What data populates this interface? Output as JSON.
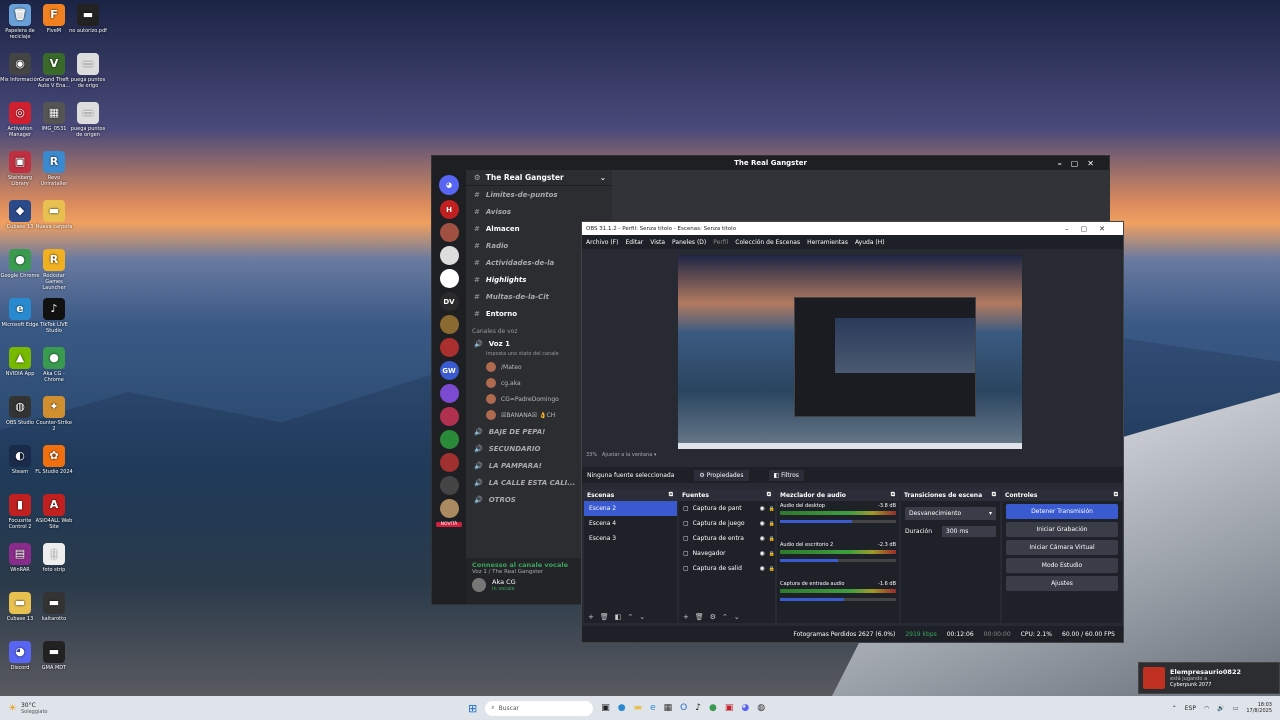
{
  "desktop": {
    "icons": [
      {
        "label": "Papelera de reciclaje",
        "glyph": "🗑",
        "color": "#6aa0d8"
      },
      {
        "label": "FiveM",
        "glyph": "F",
        "color": "#f08020"
      },
      {
        "label": "no autorizo.pdf",
        "glyph": "▬",
        "color": "#222"
      },
      {
        "label": "Mis Información",
        "glyph": "◉",
        "color": "#444"
      },
      {
        "label": "Grand Theft Auto V Ena...",
        "glyph": "V",
        "color": "#3a6a2a"
      },
      {
        "label": "puega puntos de origo",
        "glyph": "▭",
        "color": "#ddd"
      },
      {
        "label": "Activation Manager",
        "glyph": "◎",
        "color": "#d02030"
      },
      {
        "label": "IMG_0531",
        "glyph": "▦",
        "color": "#555"
      },
      {
        "label": "puega puntos de origen",
        "glyph": "▭",
        "color": "#ddd"
      },
      {
        "label": "Steinberg Library",
        "glyph": "▣",
        "color": "#c03040"
      },
      {
        "label": "Revo Uninstaller",
        "glyph": "R",
        "color": "#3a8ad0"
      },
      {
        "label": "Cubase 13",
        "glyph": "◆",
        "color": "#2a4a8a"
      },
      {
        "label": "Nueva carpeta",
        "glyph": "▬",
        "color": "#e8c050"
      },
      {
        "label": "Google Chrome",
        "glyph": "●",
        "color": "#3a9a50"
      },
      {
        "label": "Rockstar Games Launcher",
        "glyph": "R",
        "color": "#f0b020"
      },
      {
        "label": "Microsoft Edge",
        "glyph": "e",
        "color": "#2a8ad0"
      },
      {
        "label": "TikTok LIVE Studio",
        "glyph": "♪",
        "color": "#111"
      },
      {
        "label": "NVIDIA App",
        "glyph": "▲",
        "color": "#76b900"
      },
      {
        "label": "Aka CG - Chrome",
        "glyph": "●",
        "color": "#3a9a50"
      },
      {
        "label": "OBS Studio",
        "glyph": "◍",
        "color": "#333"
      },
      {
        "label": "Counter-Strike 2",
        "glyph": "✦",
        "color": "#d09030"
      },
      {
        "label": "Steam",
        "glyph": "◐",
        "color": "#1a2a4a"
      },
      {
        "label": "FL Studio 2024",
        "glyph": "✿",
        "color": "#f07010"
      },
      {
        "label": "Focusrite Control 2",
        "glyph": "▮",
        "color": "#c02020"
      },
      {
        "label": "ASIO4ALL Web Site",
        "glyph": "A",
        "color": "#c02020"
      },
      {
        "label": "WinRAR",
        "glyph": "▤",
        "color": "#8a2a8a"
      },
      {
        "label": "foto strip",
        "glyph": "▯",
        "color": "#eee"
      },
      {
        "label": "Cubase 13",
        "glyph": "▬",
        "color": "#e8c050"
      },
      {
        "label": "kaitarotto",
        "glyph": "▬",
        "color": "#333"
      },
      {
        "label": "Discord",
        "glyph": "◕",
        "color": "#5865f2"
      },
      {
        "label": "GMA MDT",
        "glyph": "▬",
        "color": "#222"
      }
    ]
  },
  "discord": {
    "window_title": "The Real Gangster",
    "server_name": "The Real Gangster",
    "text_channels": [
      "Limites-de-puntos",
      "Avisos",
      "Almacen",
      "Radio",
      "Actividades-de-la",
      "Highlights",
      "Multas-de-la-Cit",
      "Entorno"
    ],
    "voice_header": "Canales de voz",
    "voice_channel": "Voz 1",
    "voice_status": "Imposta uno stato del canale",
    "voice_users": [
      "/Mateo",
      "cg.aka",
      "CG=PadreDomingo",
      "☒BANANA☒ 👌CH"
    ],
    "voice_channels": [
      "BAJE DE PEPA!",
      "SECUNDARIO",
      "LA PAMPARA!",
      "LA CALLE ESTA CALI...",
      "OTROS"
    ],
    "connected": "Connesso al canale vocale",
    "connected_sub": "Voz 1 / The Real Gangster",
    "user": "Aka CG",
    "user_status": "In vocale",
    "novita": "NOVITÀ",
    "servers": [
      {
        "label": "H",
        "color": "#c02020"
      },
      {
        "label": "",
        "color": "#a05040"
      },
      {
        "label": "",
        "color": "#ddd"
      },
      {
        "label": "",
        "color": "#fff"
      },
      {
        "label": "DV",
        "color": "#2a2a2a"
      },
      {
        "label": "",
        "color": "#8a6a30"
      },
      {
        "label": "",
        "color": "#aa3030"
      },
      {
        "label": "GW",
        "color": "#3a5ad0"
      },
      {
        "label": "",
        "color": "#7a4ad0"
      },
      {
        "label": "",
        "color": "#b03050"
      },
      {
        "label": "",
        "color": "#2a8a3a"
      },
      {
        "label": "",
        "color": "#a03030"
      },
      {
        "label": "",
        "color": "#444"
      },
      {
        "label": "",
        "color": "#aa8a60"
      }
    ]
  },
  "obs": {
    "title": "OBS 31.1.2 - Perfil: Senza titolo - Escenas: Senza titolo",
    "menu": [
      "Archivo (F)",
      "Editar",
      "Vista",
      "Paneles (D)",
      "Perfil",
      "Colección de Escenas",
      "Herramientas",
      "Ayuda (H)"
    ],
    "zoom": "33%",
    "fit": "Ajustar a la ventana",
    "no_source": "Ninguna fuente seleccionada",
    "properties": "Propiedades",
    "filters": "Filtros",
    "scenes_title": "Escenas",
    "scenes": [
      "Escena 2",
      "Escena 4",
      "Escena 3"
    ],
    "sources_title": "Fuentes",
    "sources": [
      "Captura de pant",
      "Captura de juego",
      "Captura de entra",
      "Navegador",
      "Captura de salid"
    ],
    "mixer_title": "Mezclador de audio",
    "mixer": [
      {
        "name": "Audio del desktop",
        "db": "-3.8 dB",
        "level": 0.62
      },
      {
        "name": "Audio del escritorio 2",
        "db": "-2.3 dB",
        "level": 0.5
      },
      {
        "name": "Captura de entrada audio",
        "db": "-1.6 dB",
        "level": 0.55
      }
    ],
    "transitions_title": "Transiciones de escena",
    "transition": "Desvanecimiento",
    "duration_label": "Duración",
    "duration": "300 ms",
    "controls_title": "Controles",
    "controls": [
      "Detener Transmisión",
      "Iniciar Grabación",
      "Iniciar Cámara Virtual",
      "Modo Estudio",
      "Ajustes"
    ],
    "status": {
      "dropped": "Fotogramas Perdidos 2627 (6.0%)",
      "kbps": "2919 kbps",
      "time": "00:12:06",
      "rec": "00:00:00",
      "cpu": "CPU: 2.1%",
      "fps": "60.00 / 60.00 FPS"
    }
  },
  "taskbar": {
    "weather_temp": "30°C",
    "weather_desc": "Soleggiato",
    "search": "Buscar",
    "lang": "ESP",
    "time": "18:03",
    "date": "17/8/2025"
  },
  "toast": {
    "user": "Elempresaurio0822",
    "line": "está jugando a",
    "game": "Cyberpunk 2077"
  }
}
